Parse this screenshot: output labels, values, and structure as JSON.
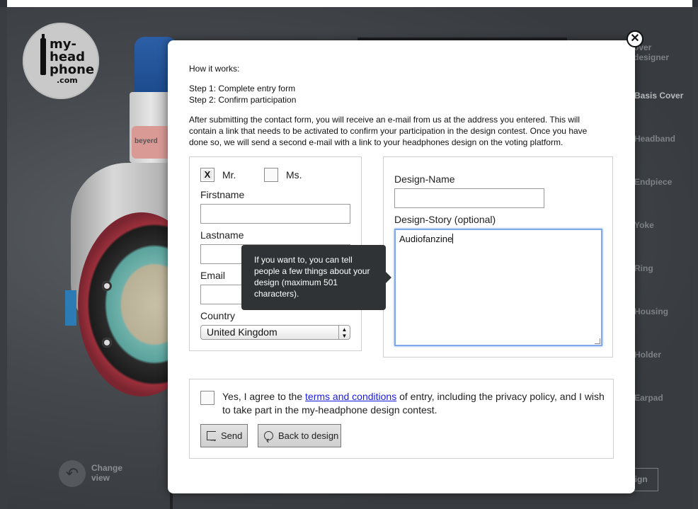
{
  "logo": {
    "line1": "my-",
    "line2": "head",
    "line3": "phone",
    "line4": ".com"
  },
  "headphone": {
    "brand_label": "beyerd"
  },
  "change_view": {
    "icon": "undo-arrow-icon",
    "label": "Change view"
  },
  "menu": {
    "items": [
      {
        "label": "over designer"
      },
      {
        "label": "Basis Cover",
        "active": true
      },
      {
        "label": "Headband"
      },
      {
        "label": "Endpiece"
      },
      {
        "label": "Yoke"
      },
      {
        "label": "Ring"
      },
      {
        "label": "Housing"
      },
      {
        "label": "Holder"
      },
      {
        "label": "Earpad"
      }
    ],
    "design_button": "sign"
  },
  "modal": {
    "close_icon": "close-x-icon",
    "close_glyph": "✕",
    "how_it_works": "How it works:",
    "step1": "Step 1: Complete entry form",
    "step2": "Step 2: Confirm participation",
    "description": "After submitting the contact form, you will receive an e-mail from us at the address you entered. This will contain a link that needs to be activated to confirm your participation in the design contest. Once you have done so, we will send a second e-mail with a link to your headphones design on the voting platform.",
    "salutation": {
      "mr_label": "Mr.",
      "mr_checked": true,
      "mr_mark": "X",
      "ms_label": "Ms.",
      "ms_checked": false
    },
    "firstname": {
      "label": "Firstname",
      "value": ""
    },
    "lastname": {
      "label": "Lastname",
      "value": ""
    },
    "email": {
      "label": "Email",
      "value": ""
    },
    "country": {
      "label": "Country",
      "value": "United Kingdom"
    },
    "design_name": {
      "label": "Design-Name",
      "value": ""
    },
    "design_story": {
      "label": "Design-Story (optional)",
      "value": "Audiofanzine"
    },
    "tooltip": "If you want to, you can tell people a few things about your design (maximum 501 characters).",
    "agree": {
      "before": "Yes, I agree to the ",
      "link": "terms and conditions",
      "after": " of entry, including the privacy policy, and I wish to take part in the my-headphone design contest.",
      "checked": false
    },
    "send_button": "Send",
    "back_button": "Back to design"
  }
}
